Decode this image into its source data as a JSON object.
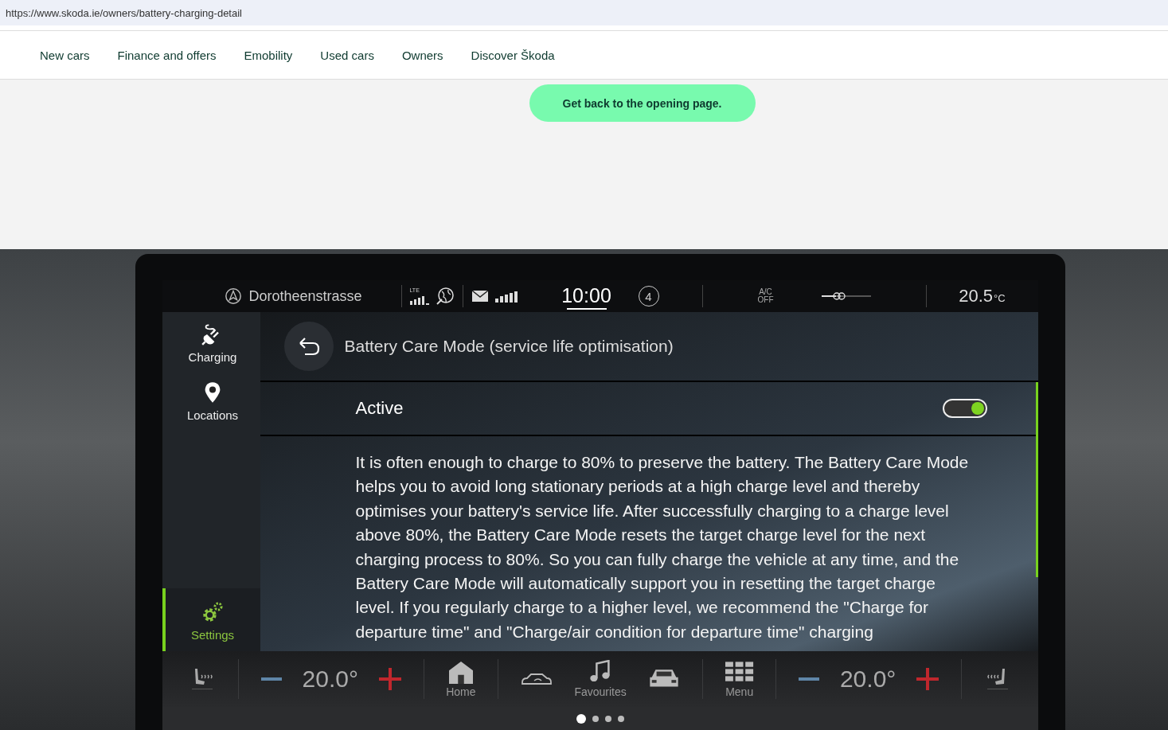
{
  "browser": {
    "url": "https://www.skoda.ie/owners/battery-charging-detail"
  },
  "nav": {
    "items": [
      {
        "label": "New cars"
      },
      {
        "label": "Finance and offers"
      },
      {
        "label": "Emobility"
      },
      {
        "label": "Used cars"
      },
      {
        "label": "Owners"
      },
      {
        "label": "Discover Škoda"
      }
    ]
  },
  "cta": {
    "label": "Get back to the opening page."
  },
  "screen": {
    "status_bar": {
      "location": "Dorotheenstrasse",
      "network": "LTE",
      "time": "10:00",
      "badge": "4",
      "ac_label": "A/C",
      "ac_state": "OFF",
      "temperature": "20.5",
      "unit": "°C"
    },
    "sidebar": {
      "items": [
        {
          "label": "Charging",
          "kind": "charging",
          "selected": false
        },
        {
          "label": "Locations",
          "kind": "locations",
          "selected": false
        },
        {
          "label": "Settings",
          "kind": "settings",
          "selected": true
        }
      ]
    },
    "page": {
      "title": "Battery Care Mode (service life optimisation)",
      "setting": {
        "label": "Active",
        "on": true
      },
      "description": "It is often enough to charge to 80% to preserve the battery. The Battery Care Mode helps you to avoid long stationary periods at a high charge level and thereby optimises your battery's service life. After successfully charging to a charge level above 80%, the Battery Care Mode resets the target charge level for the next charging process to 80%. So you can fully charge the vehicle at any time, and the Battery Care Mode will automatically support you in resetting the target charge level. If you regularly charge to a higher level, we recommend the \"Charge for departure time\" and \"Charge/air condition for departure time\" charging"
    },
    "bottom_bar": {
      "items": [
        {
          "kind": "seat"
        },
        {
          "kind": "temperature",
          "value": "20.0°"
        },
        {
          "kind": "home",
          "label": "Home"
        },
        {
          "kind": "car-swap"
        },
        {
          "kind": "favourites",
          "label": "Favourites"
        },
        {
          "kind": "car"
        },
        {
          "kind": "menu",
          "label": "Menu"
        },
        {
          "kind": "temperature",
          "value": "20.0°"
        },
        {
          "kind": "seat"
        }
      ]
    },
    "pager": [
      {
        "selected": true
      },
      {
        "selected": false
      },
      {
        "selected": false
      },
      {
        "selected": false
      }
    ]
  }
}
